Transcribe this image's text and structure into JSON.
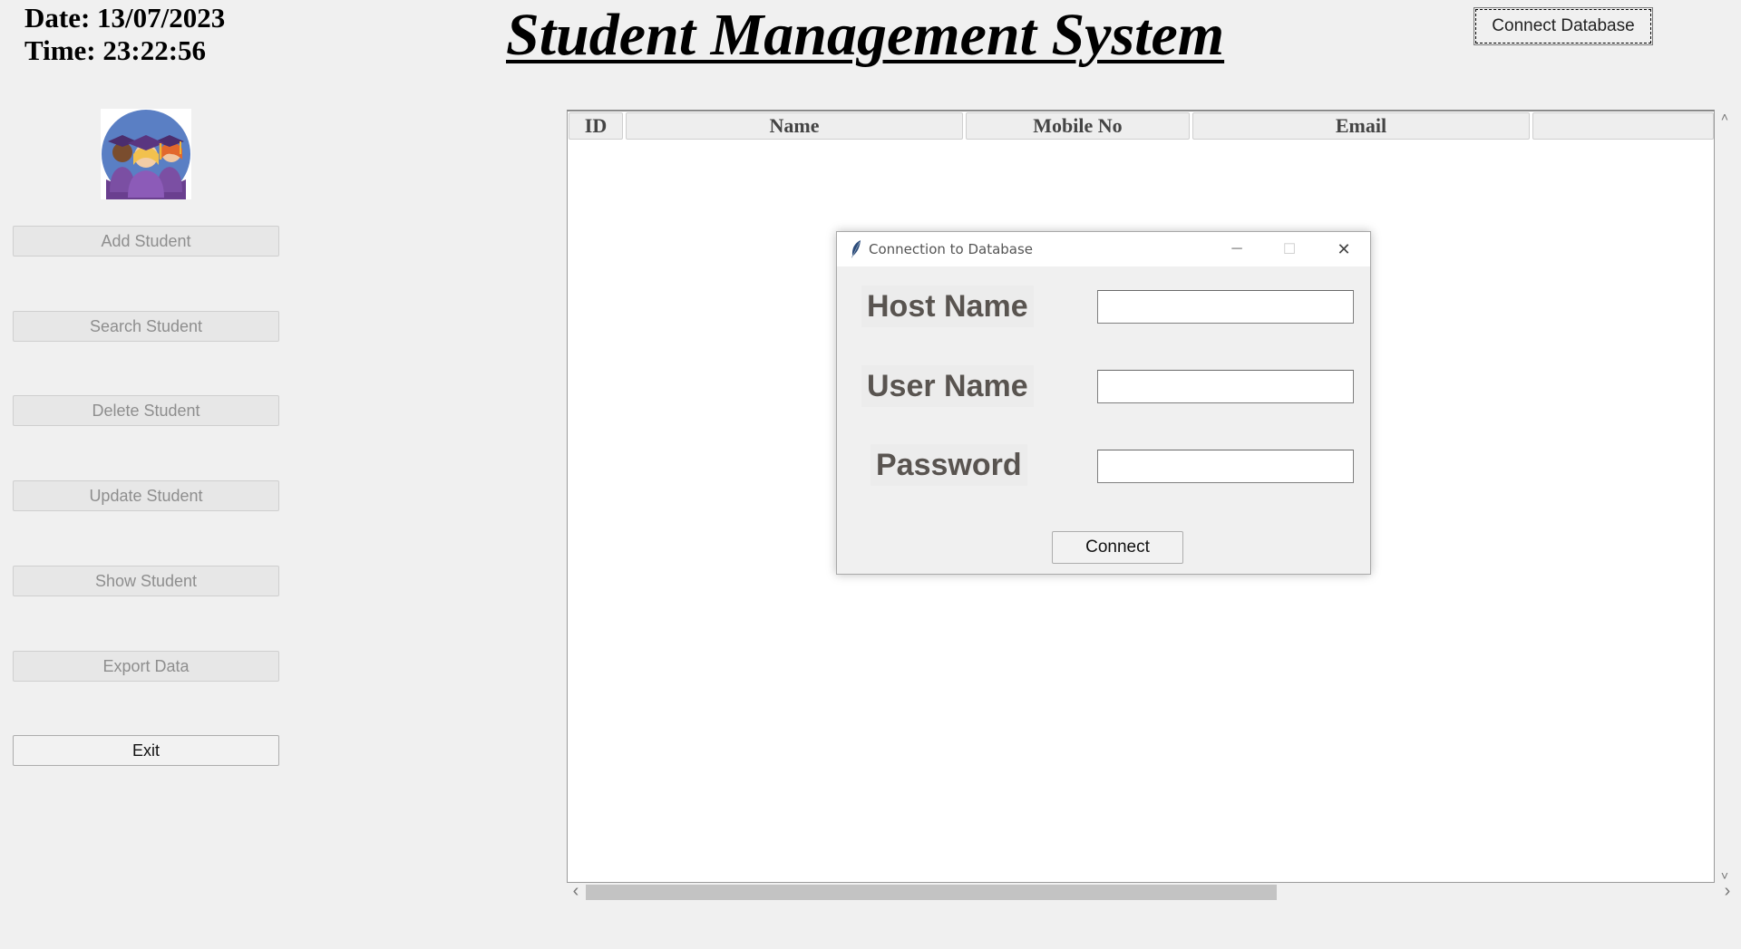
{
  "header": {
    "date": "Date: 13/07/2023",
    "time": "Time: 23:22:56",
    "title": "Student Management System",
    "connect_db_label": "Connect Database"
  },
  "sidebar": {
    "logo_icon": "students-graduation-icon",
    "buttons": [
      {
        "label": "Add Student"
      },
      {
        "label": "Search Student"
      },
      {
        "label": "Delete Student"
      },
      {
        "label": "Update Student"
      },
      {
        "label": "Show Student"
      },
      {
        "label": "Export Data"
      },
      {
        "label": "Exit"
      }
    ]
  },
  "table": {
    "columns": [
      "ID",
      "Name",
      "Mobile No",
      "Email",
      ""
    ],
    "rows": []
  },
  "dialog": {
    "title": "Connection to Database",
    "host_label": "Host Name",
    "user_label": "User Name",
    "password_label": "Password",
    "host_value": "",
    "user_value": "",
    "password_value": "",
    "connect_label": "Connect",
    "minimize_glyph": "─",
    "maximize_glyph": "☐",
    "close_glyph": "✕"
  },
  "scroll": {
    "left_arrow": "‹",
    "right_arrow": "›",
    "up_arrow": "˄",
    "down_arrow": "˅"
  }
}
